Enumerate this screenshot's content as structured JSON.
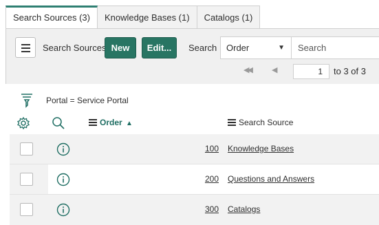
{
  "tabs": [
    {
      "label": "Search Sources (3)",
      "active": true
    },
    {
      "label": "Knowledge Bases (1)",
      "active": false
    },
    {
      "label": "Catalogs (1)",
      "active": false
    }
  ],
  "toolbar": {
    "title": "Search Sources",
    "new_label": "New",
    "edit_label": "Edit...",
    "search_label": "Search",
    "search_field_value": "Order",
    "search_placeholder": "Search"
  },
  "pager": {
    "current_page": "1",
    "range_text": "to 3 of 3"
  },
  "filter": {
    "text": "Portal = Service Portal"
  },
  "columns": {
    "order": "Order",
    "search_source": "Search Source"
  },
  "rows": [
    {
      "order": "100",
      "search_source": "Knowledge Bases"
    },
    {
      "order": "200",
      "search_source": "Questions and Answers"
    },
    {
      "order": "300",
      "search_source": "Catalogs"
    }
  ],
  "colors": {
    "accent": "#287563",
    "tab_active_border": "#2e7f72",
    "next_page_indicator": "#c1432b"
  }
}
